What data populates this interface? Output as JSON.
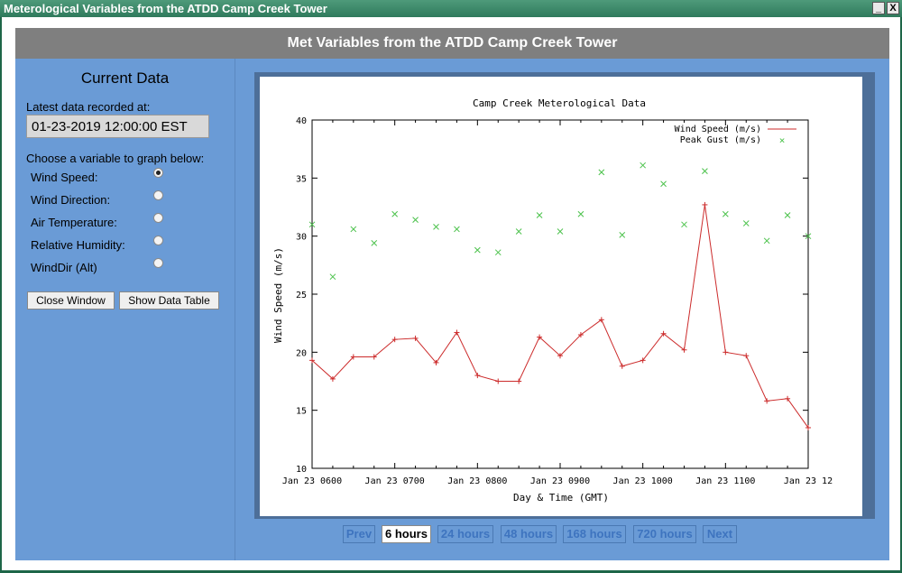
{
  "window": {
    "title": "Meterological Variables from the ATDD Camp Creek Tower",
    "minimize": "_",
    "close": "X"
  },
  "header": {
    "title": "Met Variables from the ATDD Camp Creek Tower"
  },
  "sidebar": {
    "heading": "Current Data",
    "latest_label": "Latest data recorded at:",
    "latest_value": "01-23-2019 12:00:00 EST",
    "choose_label": "Choose a variable to graph below:",
    "variables": [
      {
        "label": "Wind Speed:",
        "selected": true
      },
      {
        "label": "Wind Direction:",
        "selected": false
      },
      {
        "label": "Air Temperature:",
        "selected": false
      },
      {
        "label": "Relative Humidity:",
        "selected": false
      },
      {
        "label": "WindDir (Alt)",
        "selected": false
      }
    ],
    "close_button": "Close Window",
    "table_button": "Show Data Table"
  },
  "pager": [
    {
      "label": "Prev",
      "active": false
    },
    {
      "label": "6 hours",
      "active": true
    },
    {
      "label": "24 hours",
      "active": false
    },
    {
      "label": "48 hours",
      "active": false
    },
    {
      "label": "168 hours",
      "active": false
    },
    {
      "label": "720 hours",
      "active": false
    },
    {
      "label": "Next",
      "active": false
    }
  ],
  "chart_data": {
    "type": "line",
    "title": "Camp Creek Meterological Data",
    "xlabel": "Day & Time (GMT)",
    "ylabel": "Wind Speed (m/s)",
    "ylim": [
      10,
      40
    ],
    "yticks": [
      10,
      15,
      20,
      25,
      30,
      35,
      40
    ],
    "xticks": [
      "Jan 23 0600",
      "Jan 23 0700",
      "Jan 23 0800",
      "Jan 23 0900",
      "Jan 23 1000",
      "Jan 23 1100",
      "Jan 23 12"
    ],
    "x": [
      "06:00",
      "06:15",
      "06:30",
      "06:45",
      "07:00",
      "07:15",
      "07:30",
      "07:45",
      "08:00",
      "08:15",
      "08:30",
      "08:45",
      "09:00",
      "09:15",
      "09:30",
      "09:45",
      "10:00",
      "10:15",
      "10:30",
      "10:45",
      "11:00",
      "11:15",
      "11:30",
      "11:45",
      "12:00"
    ],
    "legend_position": "top-right",
    "grid": false,
    "series": [
      {
        "name": "Wind Speed (m/s)",
        "style": "line",
        "color": "#cc2b2b",
        "values": [
          19.3,
          17.7,
          19.6,
          19.6,
          21.1,
          21.2,
          19.1,
          21.7,
          18.0,
          17.5,
          17.5,
          21.3,
          19.7,
          21.5,
          22.8,
          18.8,
          19.3,
          21.6,
          20.2,
          32.7,
          20.0,
          19.7,
          15.8,
          16.0,
          13.5
        ]
      },
      {
        "name": "Peak Gust (m/s)",
        "style": "points",
        "color": "#4cc24c",
        "values": [
          31.0,
          26.5,
          30.6,
          29.4,
          31.9,
          31.4,
          30.8,
          30.6,
          28.8,
          28.6,
          30.4,
          31.8,
          30.4,
          31.9,
          35.5,
          30.1,
          36.1,
          34.5,
          31.0,
          35.6,
          31.9,
          31.1,
          29.6,
          31.8,
          30.0
        ]
      }
    ]
  }
}
